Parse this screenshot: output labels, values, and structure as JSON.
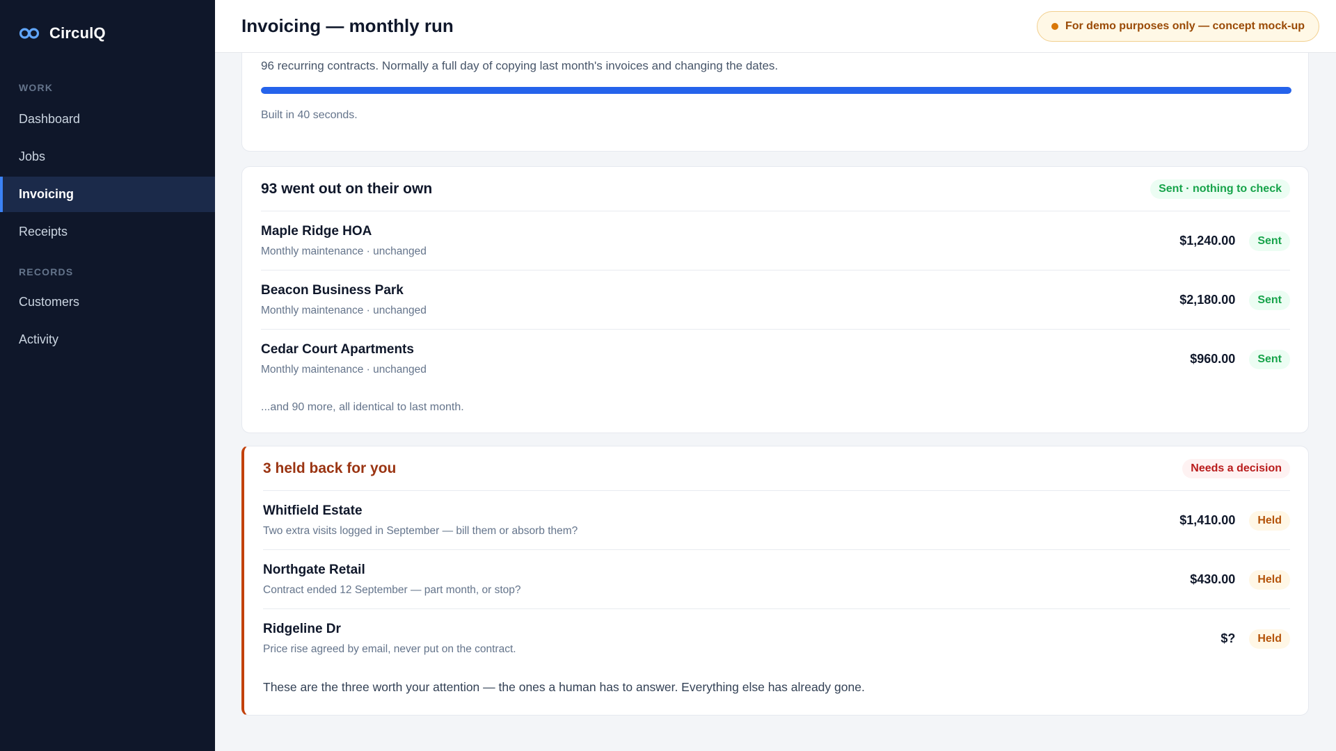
{
  "app": {
    "name": "CirculQ"
  },
  "sidebar": {
    "sections": [
      {
        "label": "WORK",
        "items": [
          {
            "label": "Dashboard"
          },
          {
            "label": "Jobs"
          },
          {
            "label": "Invoicing",
            "active": true
          },
          {
            "label": "Receipts"
          }
        ]
      },
      {
        "label": "RECORDS",
        "items": [
          {
            "label": "Customers"
          },
          {
            "label": "Activity"
          }
        ]
      }
    ]
  },
  "header": {
    "title": "Invoicing — monthly run",
    "badge": "For demo purposes only — concept mock-up"
  },
  "top_card": {
    "description": "96 recurring contracts. Normally a full day of copying last month's invoices and changing the dates.",
    "progress_percent": 100,
    "built_text": "Built in 40 seconds."
  },
  "sent_card": {
    "title": "93 went out on their own",
    "status": "Sent · nothing to check",
    "rows": [
      {
        "name": "Maple Ridge HOA",
        "sub": "Monthly maintenance · unchanged",
        "amount": "$1,240.00",
        "status": "Sent"
      },
      {
        "name": "Beacon Business Park",
        "sub": "Monthly maintenance · unchanged",
        "amount": "$2,180.00",
        "status": "Sent"
      },
      {
        "name": "Cedar Court Apartments",
        "sub": "Monthly maintenance · unchanged",
        "amount": "$960.00",
        "status": "Sent"
      }
    ],
    "footer": "...and 90 more, all identical to last month."
  },
  "held_card": {
    "title": "3 held back for you",
    "status": "Needs a decision",
    "rows": [
      {
        "name": "Whitfield Estate",
        "sub": "Two extra visits logged in September — bill them or absorb them?",
        "amount": "$1,410.00",
        "status": "Held"
      },
      {
        "name": "Northgate Retail",
        "sub": "Contract ended 12 September — part month, or stop?",
        "amount": "$430.00",
        "status": "Held"
      },
      {
        "name": "Ridgeline Dr",
        "sub": "Price rise agreed by email, never put on the contract.",
        "amount": "$?",
        "status": "Held"
      }
    ],
    "footer": "These are the three worth your attention — the ones a human has to answer. Everything else has already gone."
  },
  "colors": {
    "accent": "#2563eb",
    "sidebar": "#0f172a",
    "sent": "#16a34a",
    "held": "#c2410c",
    "alert": "#b91c1c"
  }
}
